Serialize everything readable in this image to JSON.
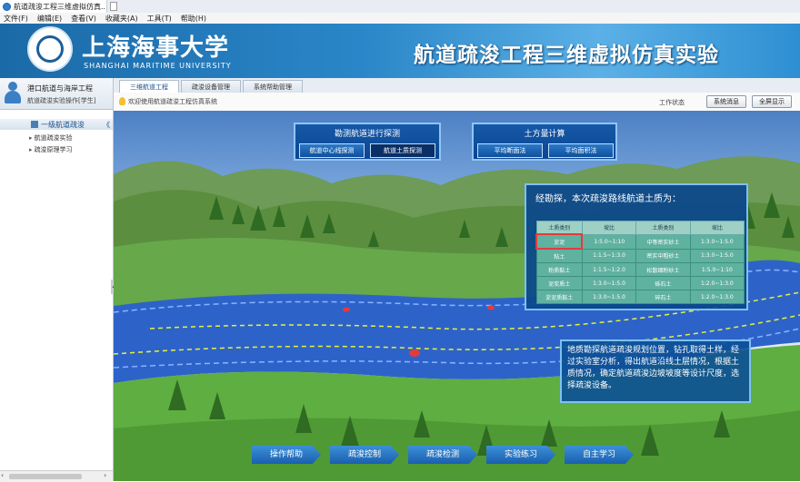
{
  "browser": {
    "tab_title": "航道疏浚工程三维虚拟仿真...",
    "close_glyph": "×"
  },
  "menu": [
    "文件(F)",
    "编辑(E)",
    "查看(V)",
    "收藏夹(A)",
    "工具(T)",
    "帮助(H)"
  ],
  "header": {
    "university_cn": "上海海事大学",
    "university_en": "SHANGHAI MARITIME UNIVERSITY",
    "title": "航道疏浚工程三维虚拟仿真实验"
  },
  "sidebar": {
    "user_line1": "港口航道与海岸工程",
    "user_line2": "航道疏浚实验操作[学生]",
    "nav_header": "一级航道疏浚",
    "nav_toggle": "《",
    "items": [
      "航道疏浚实验",
      "疏浚原理学习"
    ],
    "collapse_glyph": "◂",
    "scroll_left": "‹",
    "scroll_right": "›"
  },
  "content_tabs": [
    "三维航道工程",
    "疏浚设备管理",
    "系统帮助管理"
  ],
  "subbar": {
    "hint": "欢迎使用航道疏浚工程仿真系统",
    "right_label": "工作状态",
    "buttons": [
      "系统消息",
      "全屏显示"
    ]
  },
  "scene": {
    "survey_panel": {
      "title": "勘测航道进行探测",
      "buttons": [
        "航道中心线探测",
        "航道土质探测"
      ]
    },
    "earth_panel": {
      "title": "土方量计算",
      "buttons": [
        "平均断面法",
        "平均面积法"
      ]
    },
    "info": {
      "heading": "经勘探，本次疏浚路线航道土质为：",
      "columns": [
        "土质类别",
        "坡比",
        "土质类别",
        "坡比"
      ],
      "rows": [
        [
          "淤泥",
          "1:5.0~1:10",
          "中等密实砂土",
          "1:3.0~1:5.0"
        ],
        [
          "粘土",
          "1:1.5~1:3.0",
          "密实中粗砂土",
          "1:3.0~1:5.0"
        ],
        [
          "粉质黏土",
          "1:1.5~1:2.0",
          "松散细粉砂土",
          "1:5.0~1:10"
        ],
        [
          "泥炭质土",
          "1:3.0~1:5.0",
          "砾石土",
          "1:2.0~1:3.0"
        ],
        [
          "淤泥质黏土",
          "1:3.0~1:5.0",
          "碎石土",
          "1:2.0~1:3.0"
        ]
      ]
    },
    "description": "地质勘探航道疏浚规划位置，钻孔取得土样，经过实验室分析，得出航道沿线土层情况，根据土质情况，确定航道疏浚边坡坡度等设计尺度，选择疏浚设备。",
    "bottom_buttons": [
      "操作帮助",
      "疏浚控制",
      "疏浚检测",
      "实验练习",
      "自主学习"
    ]
  },
  "colors": {
    "header_blue": "#2a86c8",
    "panel_blue": "#1559a8",
    "table_green": "#5fb1a0",
    "highlight_red": "#e23b3b"
  }
}
